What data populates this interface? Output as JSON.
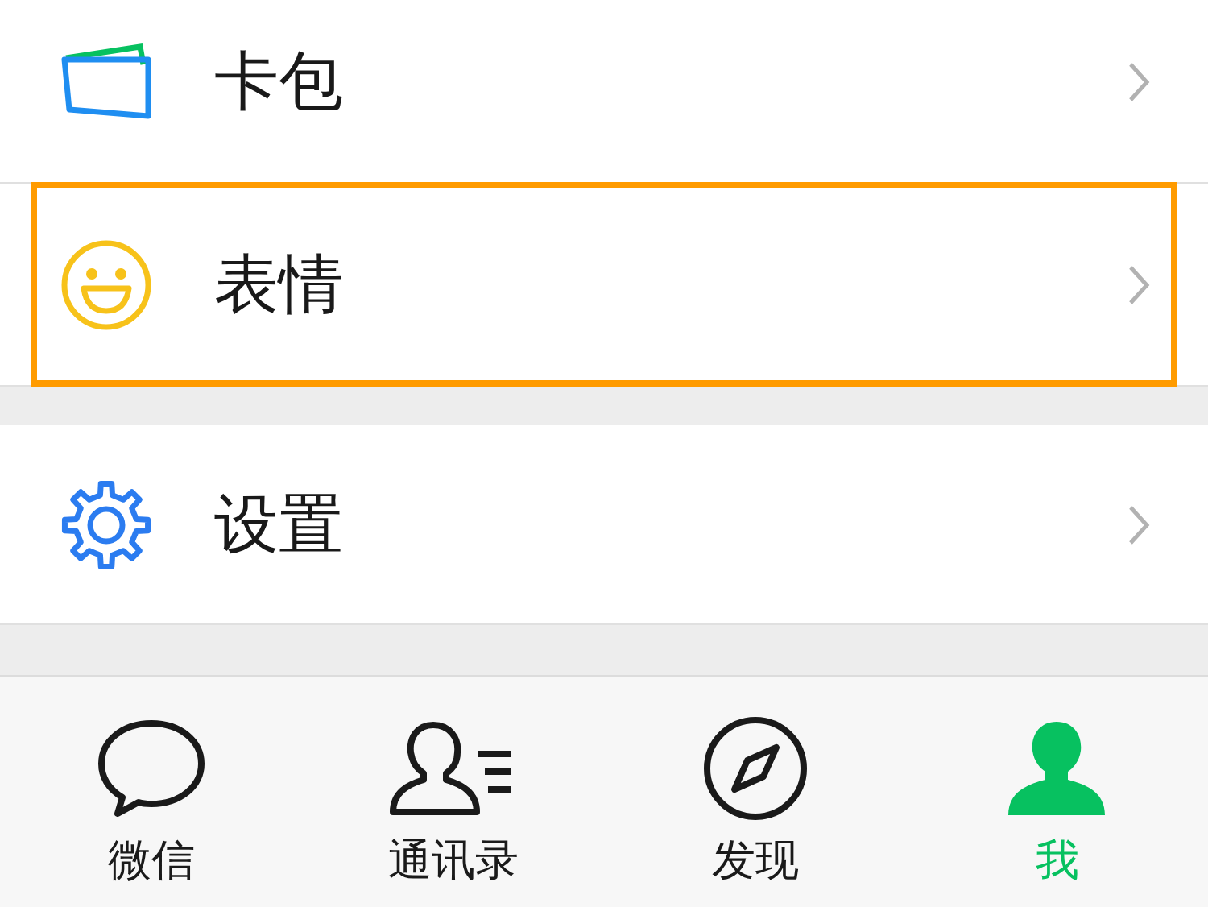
{
  "groups": [
    {
      "items": [
        {
          "kind": "wallet",
          "label": "卡包",
          "highlighted": false
        },
        {
          "kind": "emoji",
          "label": "表情",
          "highlighted": true
        }
      ]
    },
    {
      "items": [
        {
          "kind": "settings",
          "label": "设置",
          "highlighted": false
        }
      ]
    }
  ],
  "tab_bar": [
    {
      "kind": "chat",
      "label": "微信",
      "selected": false
    },
    {
      "kind": "contacts",
      "label": "通讯录",
      "selected": false
    },
    {
      "kind": "discover",
      "label": "发现",
      "selected": false
    },
    {
      "kind": "me",
      "label": "我",
      "selected": true
    }
  ]
}
